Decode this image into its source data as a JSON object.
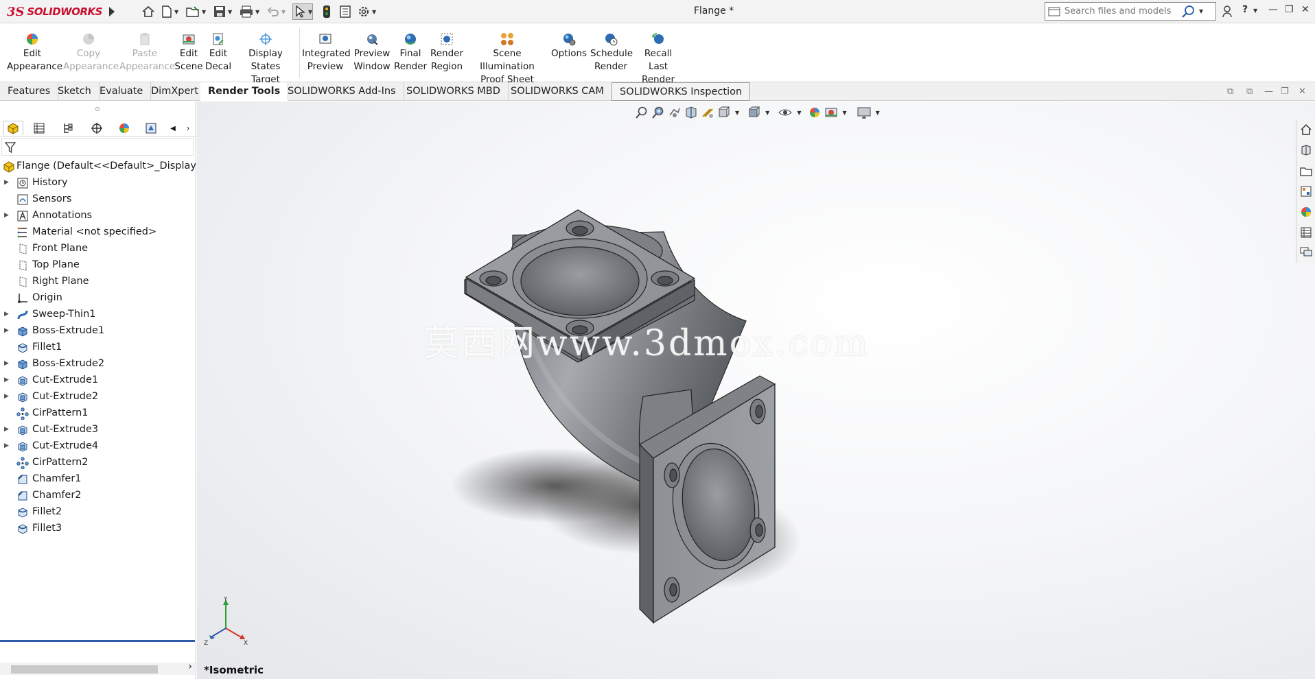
{
  "app": {
    "brand": "SOLIDWORKS",
    "ds": "3S",
    "document_title": "Flange *"
  },
  "search": {
    "placeholder": "Search files and models"
  },
  "ribbon": [
    {
      "label1": "Edit",
      "label2": "Appearance",
      "enabled": true
    },
    {
      "label1": "Copy",
      "label2": "Appearance",
      "enabled": false
    },
    {
      "label1": "Paste",
      "label2": "Appearance",
      "enabled": false
    },
    {
      "label1": "Edit",
      "label2": "Scene",
      "enabled": true
    },
    {
      "label1": "Edit",
      "label2": "Decal",
      "enabled": true
    },
    {
      "label1": "Display States",
      "label2": "Target",
      "enabled": true
    },
    {
      "label1": "Integrated",
      "label2": "Preview",
      "enabled": true
    },
    {
      "label1": "Preview",
      "label2": "Window",
      "enabled": true
    },
    {
      "label1": "Final",
      "label2": "Render",
      "enabled": true
    },
    {
      "label1": "Render",
      "label2": "Region",
      "enabled": true
    },
    {
      "label1": "Scene Illumination",
      "label2": "Proof Sheet",
      "enabled": true
    },
    {
      "label1": "Options",
      "label2": "",
      "enabled": true
    },
    {
      "label1": "Schedule",
      "label2": "Render",
      "enabled": true
    },
    {
      "label1": "Recall Last",
      "label2": "Render",
      "enabled": true
    }
  ],
  "tabs": [
    {
      "label": "Features"
    },
    {
      "label": "Sketch"
    },
    {
      "label": "Evaluate"
    },
    {
      "label": "DimXpert"
    },
    {
      "label": "Render Tools",
      "active": true
    },
    {
      "label": "SOLIDWORKS Add-Ins"
    },
    {
      "label": "SOLIDWORKS MBD"
    },
    {
      "label": "SOLIDWORKS CAM"
    },
    {
      "label": "SOLIDWORKS Inspection"
    }
  ],
  "tree": {
    "root": "Flange  (Default<<Default>_Display St",
    "items": [
      {
        "label": "History",
        "expandable": true
      },
      {
        "label": "Sensors",
        "expandable": false
      },
      {
        "label": "Annotations",
        "expandable": true
      },
      {
        "label": "Material <not specified>",
        "expandable": false
      },
      {
        "label": "Front Plane",
        "expandable": false
      },
      {
        "label": "Top Plane",
        "expandable": false
      },
      {
        "label": "Right Plane",
        "expandable": false
      },
      {
        "label": "Origin",
        "expandable": false
      },
      {
        "label": "Sweep-Thin1",
        "expandable": true
      },
      {
        "label": "Boss-Extrude1",
        "expandable": true
      },
      {
        "label": "Fillet1",
        "expandable": false
      },
      {
        "label": "Boss-Extrude2",
        "expandable": true
      },
      {
        "label": "Cut-Extrude1",
        "expandable": true
      },
      {
        "label": "Cut-Extrude2",
        "expandable": true
      },
      {
        "label": "CirPattern1",
        "expandable": false
      },
      {
        "label": "Cut-Extrude3",
        "expandable": true
      },
      {
        "label": "Cut-Extrude4",
        "expandable": true
      },
      {
        "label": "CirPattern2",
        "expandable": false
      },
      {
        "label": "Chamfer1",
        "expandable": false
      },
      {
        "label": "Chamfer2",
        "expandable": false
      },
      {
        "label": "Fillet2",
        "expandable": false
      },
      {
        "label": "Fillet3",
        "expandable": false
      }
    ]
  },
  "viewport": {
    "view_name": "*Isometric",
    "watermark": "莫西网www.3dmox.com",
    "triad": {
      "x": "X",
      "y": "Y",
      "z": "Z"
    }
  },
  "colors": {
    "brand": "#c8102e",
    "rollback_bar": "#2b5aa8",
    "model": "#8e9296"
  }
}
